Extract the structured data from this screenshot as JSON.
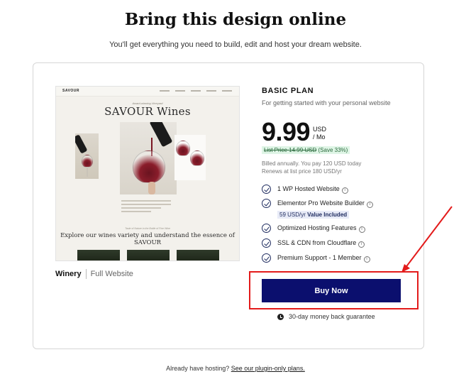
{
  "header": {
    "title": "Bring this design online",
    "subtitle": "You'll get everything you need to build, edit and host your dream website."
  },
  "preview": {
    "site_logo": "SAVOUR",
    "site_tagline": "Award-winning Vineyard",
    "site_title": "SAVOUR Wines",
    "site_small_caption": "Taste of Nature in the Bottle of Fine Wine",
    "site_heading": "Explore our wines variety and understand the essence of SAVOUR",
    "template_name": "Winery",
    "template_type": "Full Website"
  },
  "plan": {
    "name": "BASIC PLAN",
    "description": "For getting started with your personal website",
    "price": "9.99",
    "currency": "USD",
    "period": "/ Mo",
    "list_price": "List Price 14.99 USD",
    "savings": "(Save 33%)",
    "billed_line1": "Billed annually. You pay 120 USD today",
    "billed_line2": "Renews at list price 180 USD/yr",
    "features": [
      {
        "label": "1 WP Hosted Website"
      },
      {
        "label": "Elementor Pro Website Builder",
        "badge_value": "59 USD/yr",
        "badge_text": "Value Included"
      },
      {
        "label": "Optimized Hosting Features"
      },
      {
        "label": "SSL & CDN from Cloudflare"
      },
      {
        "label": "Premium Support - 1 Member"
      }
    ],
    "buy_label": "Buy Now",
    "guarantee": "30-day money back guarantee"
  },
  "footer": {
    "text": "Already have hosting?",
    "link": "See our plugin-only plans."
  },
  "colors": {
    "primary_button": "#0b0f6e",
    "highlight": "#e31b1b",
    "savings_bg": "#dff5e6"
  }
}
